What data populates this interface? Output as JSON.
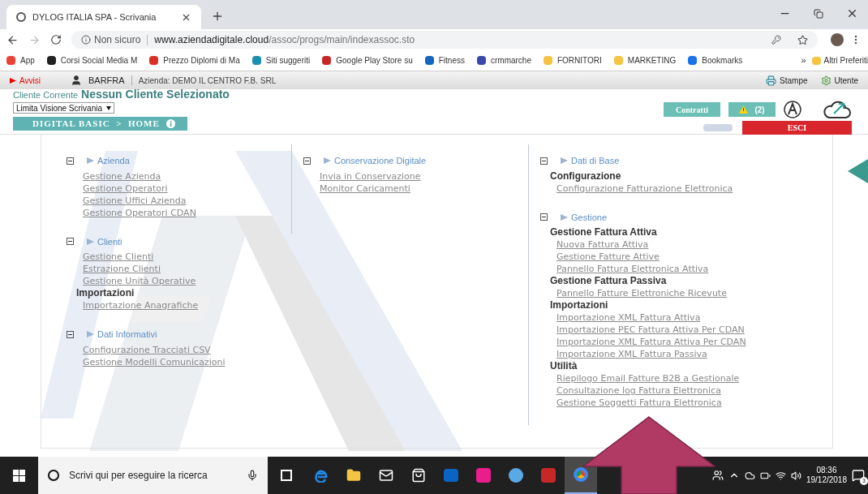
{
  "browser": {
    "tab_title": "DYLOG ITALIA SPA - Scrivania",
    "security": "Non sicuro",
    "url_host": "www.aziendadigitale.cloud",
    "url_path": "/assoc/progs/main/indexassoc.sto",
    "bookmarks": [
      {
        "label": "App",
        "color": "#ea4335"
      },
      {
        "label": "Corsi Social Media M",
        "color": "#222222"
      },
      {
        "label": "Prezzo Diplomi di Ma",
        "color": "#d93025"
      },
      {
        "label": "Siti suggeriti",
        "color": "#1a8fb0"
      },
      {
        "label": "Google Play Store su",
        "color": "#c62828"
      },
      {
        "label": "Fitness",
        "color": "#1565c0"
      },
      {
        "label": "crmmarche",
        "color": "#3949ab"
      },
      {
        "label": "FORNITORI",
        "color": "#f6c343"
      },
      {
        "label": "MARKETING",
        "color": "#f6c343"
      },
      {
        "label": "Bookmarks",
        "color": "#1a73e8"
      }
    ],
    "more": "»",
    "other_bookmarks": "Altri Preferiti"
  },
  "app_bar": {
    "alerts": "Avvisi",
    "user": "BARFRA",
    "company": "Azienda: DEMO IL CENTRO F.B. SRL",
    "print": "Stampe",
    "user_menu": "Utente"
  },
  "client": {
    "label": "Cliente Corrente",
    "value": "Nessun Cliente Selezionato",
    "filter": "Limita Visione Scrivania",
    "breadcrumb": "DIGITAL BASIC  >  HOME"
  },
  "actions": {
    "contracts": "Contratti",
    "warnings": "(2)",
    "exit": "ESCI"
  },
  "columns": [
    [
      {
        "title": "Azienda",
        "expanded": true,
        "items": [
          {
            "kind": "link",
            "text": "Gestione Azienda"
          },
          {
            "kind": "link",
            "text": "Gestione Operatori"
          },
          {
            "kind": "link",
            "text": "Gestione Uffici Azienda"
          },
          {
            "kind": "link",
            "text": "Gestione Operatori CDAN"
          }
        ]
      },
      {
        "title": "Clienti",
        "expanded": true,
        "items": [
          {
            "kind": "link",
            "text": "Gestione Clienti"
          },
          {
            "kind": "link",
            "text": "Estrazione Clienti"
          },
          {
            "kind": "link",
            "text": "Gestione Unità Operative"
          },
          {
            "kind": "heading",
            "text": "Importazioni"
          },
          {
            "kind": "link",
            "text": "Importazione Anagrafiche"
          }
        ]
      },
      {
        "title": "Dati Informativi",
        "expanded": true,
        "items": [
          {
            "kind": "link",
            "text": "Configurazione Tracciati CSV"
          },
          {
            "kind": "link",
            "text": "Gestione Modelli Comunicazioni"
          }
        ]
      }
    ],
    [
      {
        "title": "Conservazione Digitale",
        "expanded": true,
        "items": [
          {
            "kind": "link",
            "text": "Invia in Conservazione"
          },
          {
            "kind": "link",
            "text": "Monitor Caricamenti"
          }
        ]
      }
    ],
    [
      {
        "title": "Dati di Base",
        "expanded": true,
        "items": [
          {
            "kind": "heading",
            "text": "Configurazione"
          },
          {
            "kind": "link",
            "text": "Configurazione Fatturazione Elettronica"
          }
        ]
      },
      {
        "title": "Gestione",
        "expanded": true,
        "items": [
          {
            "kind": "heading",
            "text": "Gestione Fattura Attiva"
          },
          {
            "kind": "link",
            "text": "Nuova Fattura Attiva"
          },
          {
            "kind": "link",
            "text": "Gestione Fatture Attive"
          },
          {
            "kind": "link",
            "text": "Pannello Fattura Elettronica Attiva"
          },
          {
            "kind": "heading",
            "text": "Gestione Fattura Passiva"
          },
          {
            "kind": "link",
            "text": "Pannello Fatture Elettroniche Ricevute"
          },
          {
            "kind": "heading",
            "text": "Importazioni"
          },
          {
            "kind": "link",
            "text": "Importazione XML Fattura Attiva"
          },
          {
            "kind": "link",
            "text": "Importazione PEC Fattura Attiva Per CDAN"
          },
          {
            "kind": "link",
            "text": "Importazione XML Fattura Attiva Per CDAN"
          },
          {
            "kind": "link",
            "text": "Importazione XML Fattura Passiva"
          },
          {
            "kind": "heading",
            "text": "Utilità"
          },
          {
            "kind": "link",
            "text": "Riepilogo Email Fatture B2B a Gestionale"
          },
          {
            "kind": "link",
            "text": "Consultazione log Fattura Elettronica"
          },
          {
            "kind": "link",
            "text": "Gestione Soggetti Fattura Elettronica"
          }
        ]
      }
    ]
  ],
  "taskbar": {
    "search_placeholder": "Scrivi qui per eseguire la ricerca",
    "apps": [
      {
        "active": false
      },
      {
        "active": false
      },
      {
        "active": false
      },
      {
        "active": false
      },
      {
        "active": false
      },
      {
        "active": false
      },
      {
        "active": false
      },
      {
        "active": false
      },
      {
        "active": true
      }
    ],
    "time": "08:36",
    "date": "19/12/2018",
    "notifications": "3"
  }
}
